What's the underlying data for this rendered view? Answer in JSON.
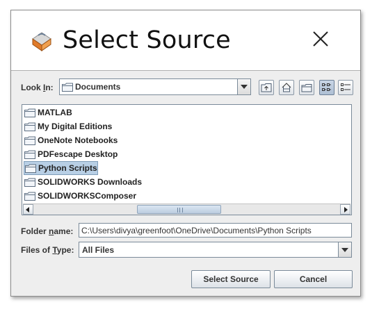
{
  "dialog": {
    "title": "Select Source",
    "app_icon": "java-coffee-icon",
    "close_icon": "close-icon"
  },
  "look_in": {
    "label_pre": "Look ",
    "label_mn": "I",
    "label_post": "n:",
    "value": "Documents"
  },
  "toolbar": {
    "buttons": [
      "up-one-level-icon",
      "home-icon",
      "new-folder-icon",
      "list-view-icon",
      "details-view-icon"
    ]
  },
  "files": {
    "items": [
      {
        "name": "MATLAB"
      },
      {
        "name": "My Digital Editions"
      },
      {
        "name": "OneNote Notebooks"
      },
      {
        "name": "PDFescape Desktop"
      },
      {
        "name": "Python Scripts"
      },
      {
        "name": "SOLIDWORKS Downloads"
      },
      {
        "name": "SOLIDWORKSComposer"
      }
    ],
    "selected_index": 4
  },
  "folder_name": {
    "label_pre": "Folder ",
    "label_mn": "n",
    "label_post": "ame:",
    "value": "C:\\Users\\divya\\greenfoot\\OneDrive\\Documents\\Python Scripts"
  },
  "files_of_type": {
    "label_pre": "Files of ",
    "label_mn": "T",
    "label_post": "ype:",
    "value": "All Files"
  },
  "actions": {
    "select_label": "Select Source",
    "cancel_label": "Cancel"
  }
}
